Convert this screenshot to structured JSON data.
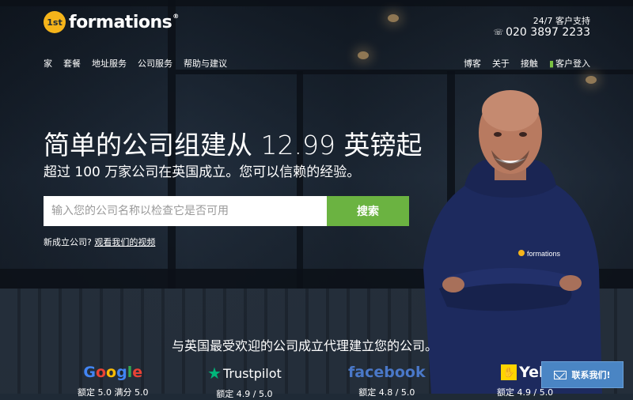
{
  "header": {
    "logo_badge": "1st",
    "logo_text": "formations",
    "logo_reg": "®",
    "support_label": "24/7 客户支持",
    "phone_icon": "☏",
    "phone": "020 3897 2233"
  },
  "nav_left": [
    "家",
    "套餐",
    "地址服务",
    "公司服务",
    "帮助与建议"
  ],
  "nav_right": {
    "blog": "博客",
    "about": "关于",
    "contact": "接触",
    "login": "客户登入"
  },
  "hero": {
    "headline": "简单的公司组建从 12.99 英镑起",
    "subline": "超过 100 万家公司在英国成立。您可以信赖的经验。",
    "search_placeholder": "输入您的公司名称以检查它是否可用",
    "search_button": "搜索",
    "new_company_text": "新成立公司?",
    "video_link": "观看我们的视频"
  },
  "person_shirt_logo": "formations",
  "reviews": {
    "tagline": "与英国最受欢迎的公司成立代理建立您的公司。",
    "items": [
      {
        "brand": "Google",
        "rating": "额定 5.0 满分 5.0"
      },
      {
        "brand": "Trustpilot",
        "rating": "额定 4.9 / 5.0"
      },
      {
        "brand": "facebook",
        "rating": "额定 4.8 / 5.0"
      },
      {
        "brand": "Yell",
        "rating": "额定 4.9 / 5.0"
      }
    ]
  },
  "contact_button": "联系我们!",
  "colors": {
    "accent_green": "#6bb341",
    "logo_yellow": "#f5b41a",
    "contact_blue": "#4a85c4"
  }
}
